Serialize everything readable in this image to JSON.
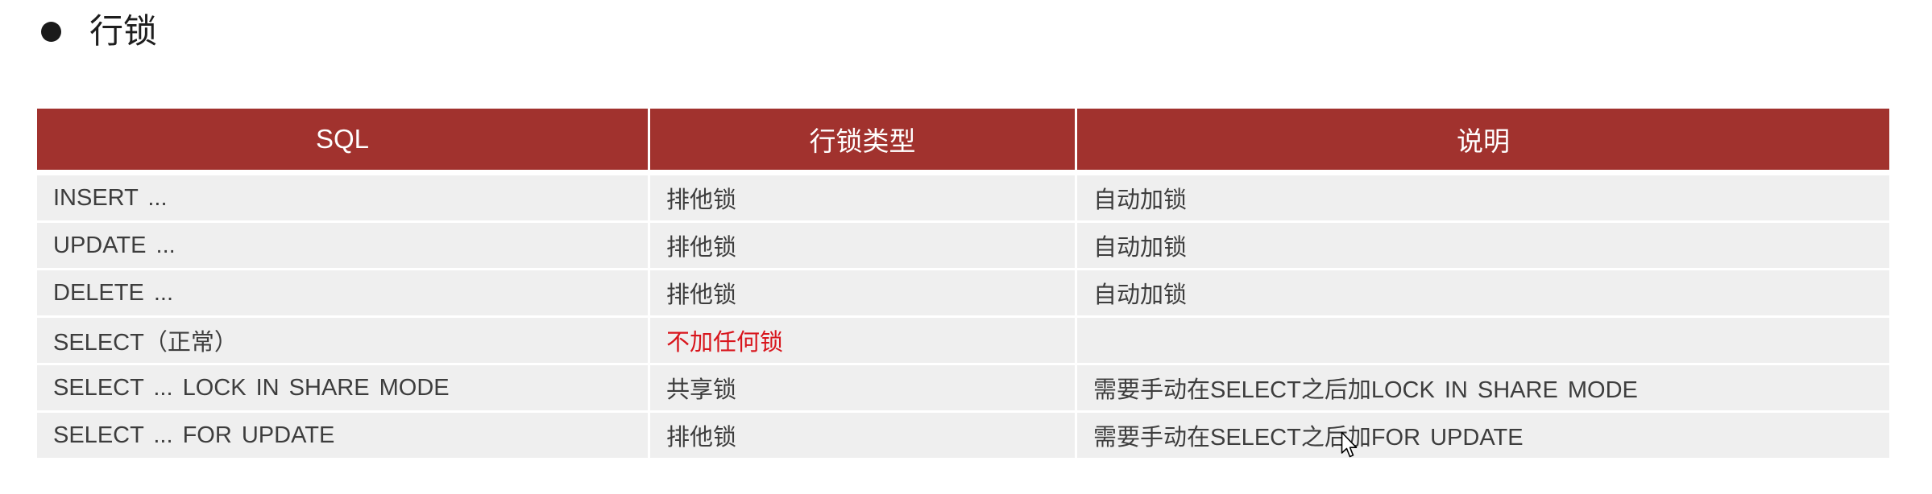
{
  "heading": {
    "icon": "bullet-icon",
    "title": "行锁"
  },
  "table": {
    "headers": {
      "sql": "SQL",
      "lock_type": "行锁类型",
      "note": "说明"
    },
    "rows": [
      {
        "sql": "INSERT ...",
        "lock_type": "排他锁",
        "note": "自动加锁"
      },
      {
        "sql": "UPDATE ...",
        "lock_type": "排他锁",
        "note": "自动加锁"
      },
      {
        "sql": "DELETE ...",
        "lock_type": "排他锁",
        "note": "自动加锁"
      },
      {
        "sql": "SELECT（正常）",
        "lock_type": "不加任何锁"
      },
      {
        "sql": "SELECT ... LOCK IN SHARE MODE",
        "lock_type": "共享锁",
        "note": "需要手动在SELECT之后加LOCK IN SHARE MODE"
      },
      {
        "sql": "SELECT ... FOR UPDATE",
        "lock_type": "排他锁",
        "note": "需要手动在SELECT之后加FOR UPDATE"
      }
    ]
  },
  "colors": {
    "header_bg": "#a1322e",
    "header_text": "#ffffff",
    "row_bg": "#efefef",
    "text": "#3d3d3d",
    "emphasis": "#d8151c",
    "title": "#1e1e1e",
    "bullet": "#1a1a1a"
  }
}
